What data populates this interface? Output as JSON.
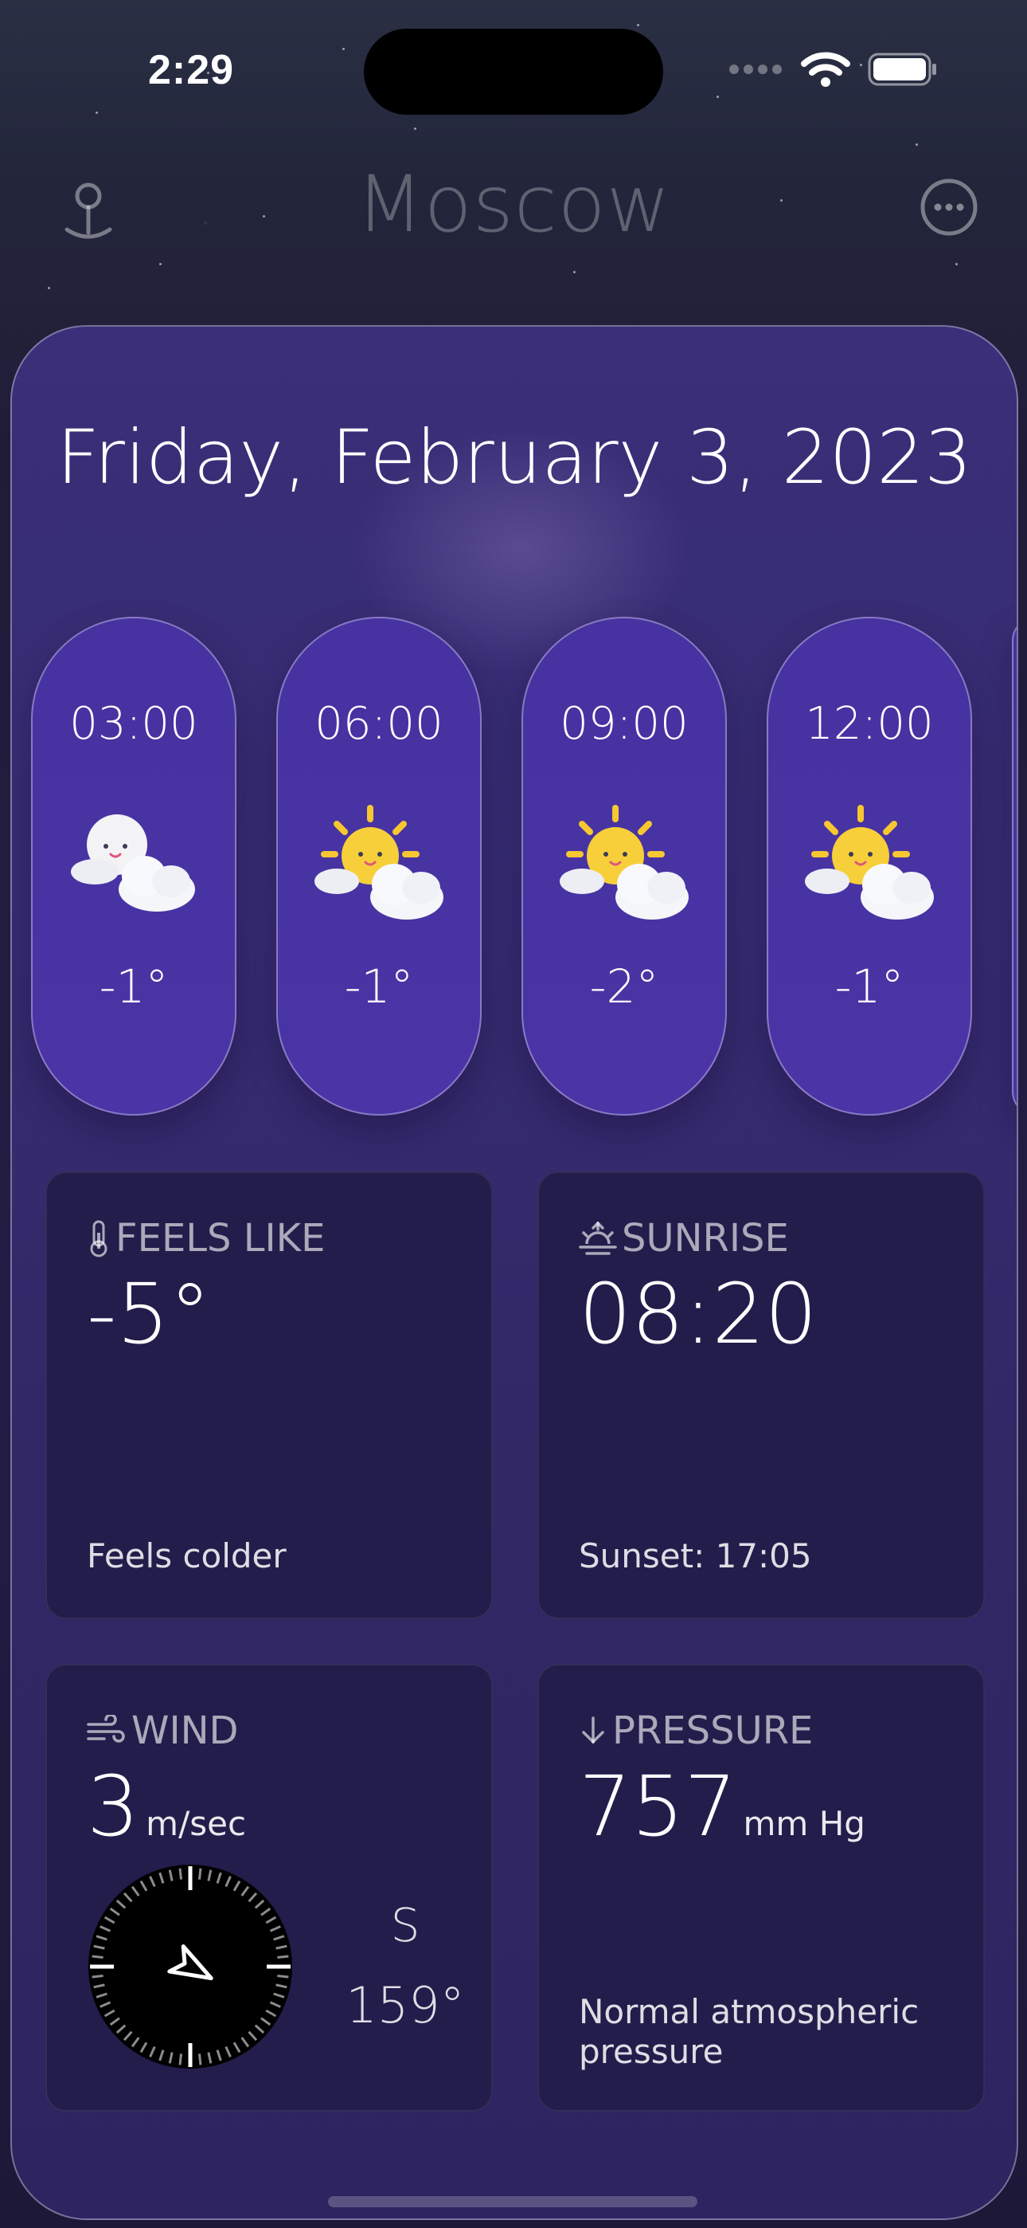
{
  "status_bar": {
    "time": "2:29"
  },
  "header": {
    "city": "Moscow"
  },
  "date": "Friday, February 3, 2023",
  "hourly": [
    {
      "time": "03:00",
      "temp": "-1°",
      "icon": "moon-cloud-icon"
    },
    {
      "time": "06:00",
      "temp": "-1°",
      "icon": "sun-cloud-icon"
    },
    {
      "time": "09:00",
      "temp": "-2°",
      "icon": "sun-cloud-icon"
    },
    {
      "time": "12:00",
      "temp": "-1°",
      "icon": "sun-cloud-icon"
    }
  ],
  "feels_like": {
    "label": "FEELS LIKE",
    "value": "-5°",
    "note": "Feels colder"
  },
  "sunrise": {
    "label": "SUNRISE",
    "value": "08:20",
    "note": "Sunset: 17:05"
  },
  "wind": {
    "label": "WIND",
    "value": "3",
    "unit": "m/sec",
    "direction": "S",
    "degrees": "159°",
    "degrees_value": 159
  },
  "pressure": {
    "label": "PRESSURE",
    "value": "757",
    "unit": "mm Hg",
    "note": "Normal atmospheric pressure"
  },
  "colors": {
    "card": "#362c72",
    "pill": "#4632a0",
    "tile": "#221d4b",
    "sun": "#f6c730"
  }
}
